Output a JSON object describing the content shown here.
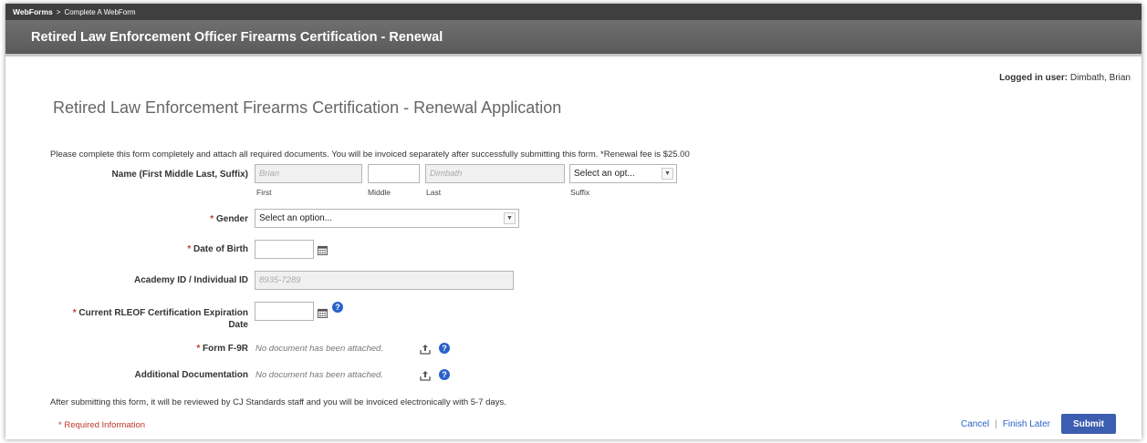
{
  "breadcrumb": {
    "root": "WebForms",
    "separator": ">",
    "current": "Complete A WebForm"
  },
  "header": {
    "title": "Retired Law Enforcement Officer Firearms Certification - Renewal"
  },
  "user": {
    "label": "Logged in user:",
    "name": "Dimbath, Brian"
  },
  "form": {
    "title": "Retired Law Enforcement Firearms Certification - Renewal Application",
    "intro": "Please complete this form completely and attach all required documents. You will be invoiced separately after successfully submitting this form. *Renewal fee is $25.00",
    "required_mark": "*",
    "name": {
      "label": "Name (First Middle Last, Suffix)",
      "first_value": "Brian",
      "middle_value": "",
      "last_value": "Dimbath",
      "suffix_selected": "Select an opt...",
      "first_sub": "First",
      "middle_sub": "Middle",
      "last_sub": "Last",
      "suffix_sub": "Suffix"
    },
    "gender": {
      "label": "Gender",
      "selected": "Select an option..."
    },
    "dob": {
      "label": "Date of Birth",
      "value": ""
    },
    "academy_id": {
      "label": "Academy ID / Individual ID",
      "value": "8935-7289"
    },
    "expiration": {
      "label_line1": "Current RLEOF Certification Expiration",
      "label_line2": "Date",
      "value": ""
    },
    "form_f9r": {
      "label": "Form F-9R",
      "status": "No document has been attached."
    },
    "additional_docs": {
      "label": "Additional Documentation",
      "status": "No document has been attached."
    },
    "footer_note": "After submitting this form, it will be reviewed by CJ Standards staff and you will be invoiced electronically with 5-7 days.",
    "required_info": "* Required Information"
  },
  "actions": {
    "cancel": "Cancel",
    "separator": "|",
    "finish_later": "Finish Later",
    "submit": "Submit"
  },
  "icons": {
    "calendar": "calendar-icon",
    "help": "help-icon",
    "upload": "upload-icon",
    "caret": "chevron-down-icon"
  },
  "colors": {
    "accent": "#3d5eb0",
    "required": "#c0392b",
    "link": "#2a62c9",
    "header_bg": "#5f5f5f"
  }
}
